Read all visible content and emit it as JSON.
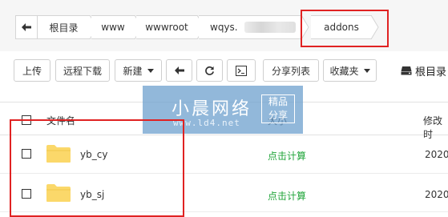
{
  "breadcrumb": {
    "back_icon": "left-arrow-icon",
    "items": [
      "根目录",
      "www",
      "wwwroot",
      "wqys.",
      "addons"
    ]
  },
  "toolbar": {
    "upload": "上传",
    "remote_download": "远程下载",
    "new": "新建",
    "back_icon": "left-arrow-icon",
    "refresh_icon": "refresh-icon",
    "terminal_icon": "terminal-icon",
    "share_list": "分享列表",
    "favorites": "收藏夹",
    "root_dir": "根目录"
  },
  "table": {
    "headers": {
      "name": "文件名",
      "size": "大小",
      "modified": "修改时"
    },
    "rows": [
      {
        "name": "yb_cy",
        "size": "点击计算",
        "modified": "2020"
      },
      {
        "name": "yb_sj",
        "size": "点击计算",
        "modified": "2020"
      }
    ]
  },
  "watermark": {
    "title": "小晨网络",
    "url": "www.ld4.net",
    "tag_line1": "精品",
    "tag_line2": "分享"
  },
  "colors": {
    "accent_green": "#20a53a",
    "annotation_red": "#e02222",
    "folder_yellow": "#fbd86a"
  }
}
